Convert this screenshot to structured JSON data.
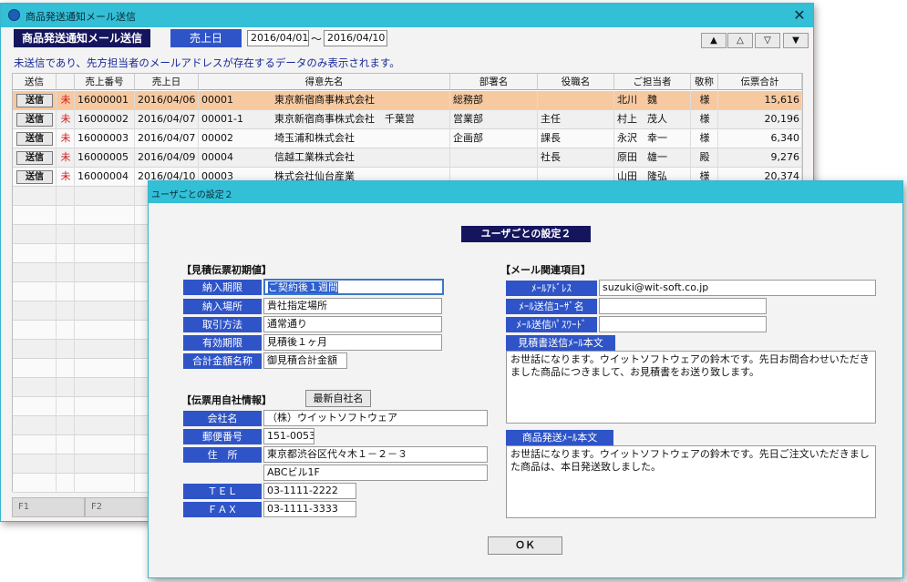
{
  "main_window": {
    "title": "商品発送通知メール送信",
    "header_title": "商品発送通知メール送信",
    "date_label": "売上日",
    "date_from": "2016/04/01",
    "date_to": "2016/04/10",
    "nav": [
      "▲",
      "△",
      "▽",
      "▼"
    ],
    "info_text": "未送信であり、先方担当者のメールアドレスが存在するデータのみ表示されます。",
    "columns": [
      "送信",
      "",
      "売上番号",
      "売上日",
      "得意先名",
      "部署名",
      "役職名",
      "ご担当者",
      "敬称",
      "伝票合計"
    ],
    "rows": [
      {
        "send": "送信",
        "flag": "未",
        "no": "16000001",
        "date": "2016/04/06",
        "code": "00001",
        "name": "東京新宿商事株式会社",
        "dept": "総務部",
        "post": "",
        "person": "北川　魏",
        "hon": "様",
        "total": "15,616"
      },
      {
        "send": "送信",
        "flag": "未",
        "no": "16000002",
        "date": "2016/04/07",
        "code": "00001-1",
        "name": "東京新宿商事株式会社　千葉営",
        "dept": "営業部",
        "post": "主任",
        "person": "村上　茂人",
        "hon": "様",
        "total": "20,196"
      },
      {
        "send": "送信",
        "flag": "未",
        "no": "16000003",
        "date": "2016/04/07",
        "code": "00002",
        "name": "埼玉浦和株式会社",
        "dept": "企画部",
        "post": "課長",
        "person": "永沢　幸一",
        "hon": "様",
        "total": "6,340"
      },
      {
        "send": "送信",
        "flag": "未",
        "no": "16000005",
        "date": "2016/04/09",
        "code": "00004",
        "name": "信越工業株式会社",
        "dept": "",
        "post": "社長",
        "person": "原田　雄一",
        "hon": "殿",
        "total": "9,276"
      },
      {
        "send": "送信",
        "flag": "未",
        "no": "16000004",
        "date": "2016/04/10",
        "code": "00003",
        "name": "株式会社仙台産業",
        "dept": "",
        "post": "",
        "person": "山田　隆弘",
        "hon": "様",
        "total": "20,374"
      }
    ],
    "fkeys": [
      "F1",
      "F2"
    ]
  },
  "dialog": {
    "title": "ユーザごとの設定２",
    "heading": "ユーザごとの設定２",
    "estimate": {
      "section": "【見積伝票初期値】",
      "fields": [
        {
          "label": "納入期限",
          "value": "ご契約後１週間"
        },
        {
          "label": "納入場所",
          "value": "貴社指定場所"
        },
        {
          "label": "取引方法",
          "value": "通常通り"
        },
        {
          "label": "有効期限",
          "value": "見積後１ヶ月"
        },
        {
          "label": "合計金額名称",
          "value": "御見積合計金額"
        }
      ]
    },
    "company": {
      "section": "【伝票用自社情報】",
      "latest_button": "最新自社名",
      "fields": [
        {
          "label": "会社名",
          "value": "（株）ウイットソフトウェア"
        },
        {
          "label": "郵便番号",
          "value": "151-0053"
        },
        {
          "label": "住　所",
          "value": "東京都渋谷区代々木１－２－３"
        },
        {
          "label": "",
          "value": "ABCビル1F"
        },
        {
          "label": "ＴＥＬ",
          "value": "03-1111-2222"
        },
        {
          "label": "ＦＡＸ",
          "value": "03-1111-3333"
        }
      ]
    },
    "mail": {
      "section": "【メール関連項目】",
      "address_label": "ﾒｰﾙｱﾄﾞﾚｽ",
      "address": "suzuki@wit-soft.co.jp",
      "user_label": "ﾒｰﾙ送信ﾕｰｻﾞ名",
      "user": "",
      "pass_label": "ﾒｰﾙ送信ﾊﾟｽﾜｰﾄﾞ",
      "pass": "",
      "estimate_body_label": "見積書送信ﾒｰﾙ本文",
      "estimate_body": "お世話になります。ウイットソフトウェアの鈴木です。先日お問合わせいただきました商品につきまして、お見積書をお送り致します。",
      "ship_body_label": "商品発送ﾒｰﾙ本文",
      "ship_body": "お世話になります。ウイットソフトウェアの鈴木です。先日ご注文いただきました商品は、本日発送致しました。"
    },
    "ok_label": "ＯＫ"
  }
}
